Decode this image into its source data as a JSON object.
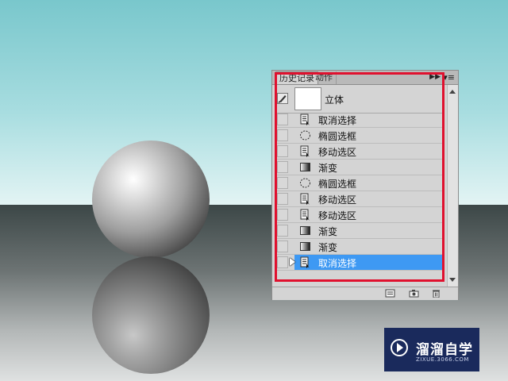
{
  "panel": {
    "tabs": [
      {
        "label": "历史记录",
        "active": true
      },
      {
        "label": "动作",
        "active": false
      }
    ],
    "forward_glyph": "▶▶",
    "menu_glyph": "▾≡",
    "snapshot": {
      "label": "立体",
      "icon": "history-brush-icon"
    },
    "items": [
      {
        "label": "取消选择",
        "icon": "step-doc-icon",
        "selected": false
      },
      {
        "label": "椭圆选框",
        "icon": "ellipse-marquee-icon",
        "selected": false
      },
      {
        "label": "移动选区",
        "icon": "step-doc-icon",
        "selected": false
      },
      {
        "label": "渐变",
        "icon": "gradient-icon",
        "selected": false
      },
      {
        "label": "椭圆选框",
        "icon": "ellipse-marquee-icon",
        "selected": false
      },
      {
        "label": "移动选区",
        "icon": "step-doc-icon",
        "selected": false
      },
      {
        "label": "移动选区",
        "icon": "step-doc-icon",
        "selected": false
      },
      {
        "label": "渐变",
        "icon": "gradient-icon",
        "selected": false
      },
      {
        "label": "渐变",
        "icon": "gradient-icon",
        "selected": false
      },
      {
        "label": "取消选择",
        "icon": "step-doc-icon",
        "selected": true
      }
    ],
    "footer_icons": [
      "new-document-from-state-icon",
      "camera-snapshot-icon",
      "trash-icon"
    ]
  },
  "highlight_color": "#e0102e",
  "selection_color": "#3e99f3",
  "watermark": {
    "title": "溜溜自学",
    "subtitle": "ZIXUE.3066.COM"
  }
}
